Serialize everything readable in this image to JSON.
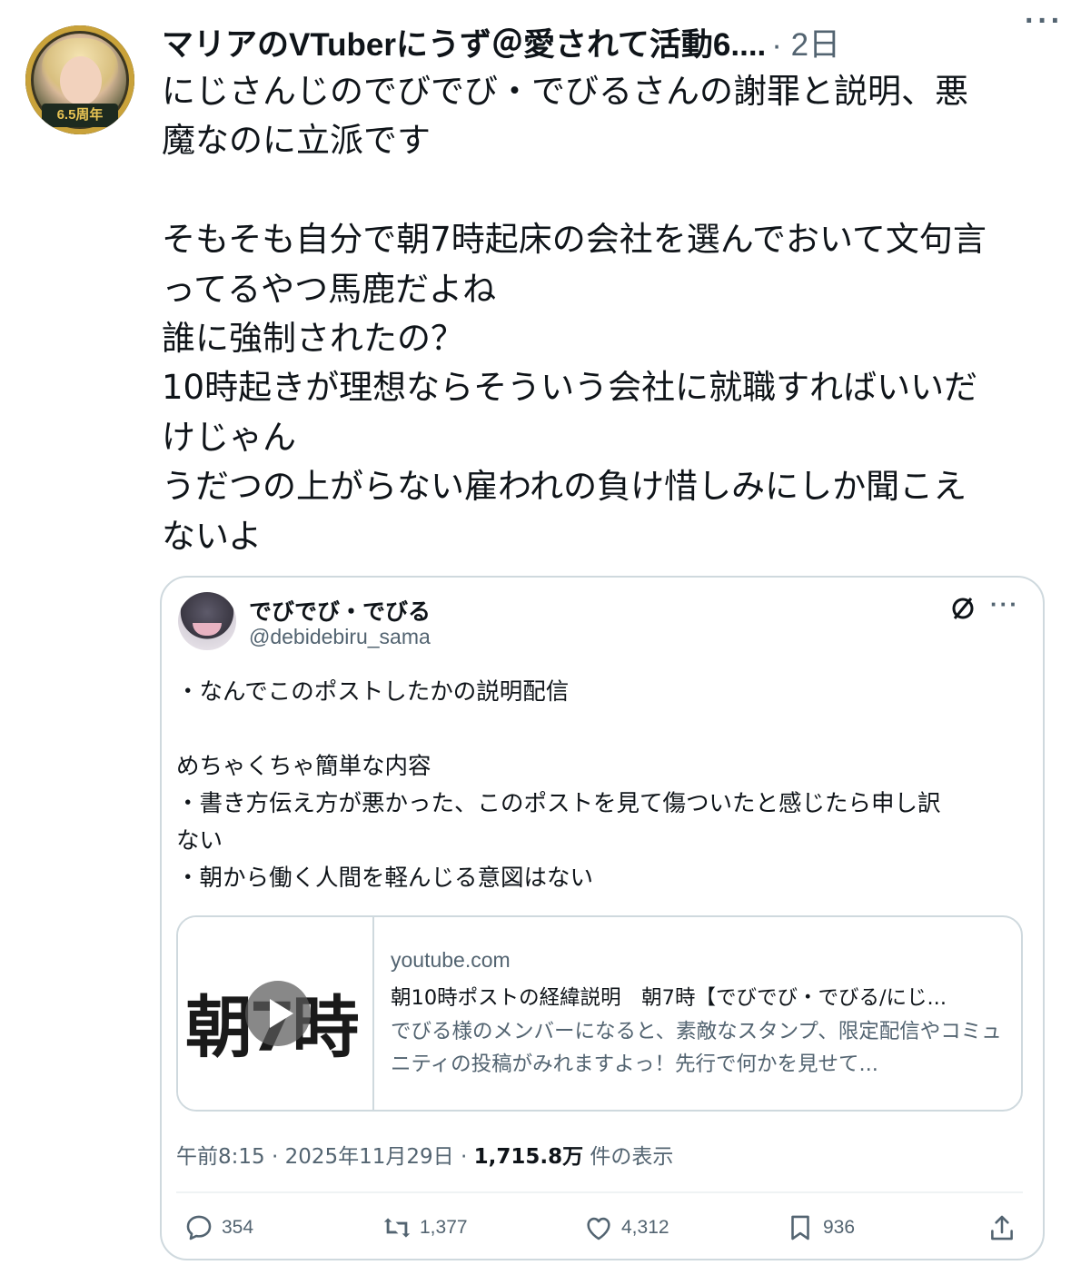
{
  "post": {
    "display_name": "マリアのVTuberにうず＠愛されて活動6....",
    "meta": "· 2日",
    "avatar_badge": "6.5周年",
    "lines": [
      "にじさんじのでびでび・でびるさんの謝罪と説明、悪",
      "魔なのに立派です",
      "",
      "そもそも自分で朝7時起床の会社を選んでおいて文句言",
      "ってるやつ馬鹿だよね",
      "誰に強制されたの？",
      "10時起きが理想ならそういう会社に就職すればいいだ",
      "けじゃん",
      "うだつの上がらない雇われの負け惜しみにしか聞こえ",
      "ないよ"
    ]
  },
  "quote": {
    "name": "でびでび・でびる",
    "handle": "@debidebiru_sama",
    "lines": [
      "・なんでこのポストしたかの説明配信",
      "",
      "めちゃくちゃ簡単な内容",
      "・書き方伝え方が悪かった、このポストを見て傷ついたと感じたら申し訳",
      "ない",
      "・朝から働く人間を軽んじる意図はない"
    ],
    "card": {
      "thumb_text": "朝7時",
      "domain": "youtube.com",
      "title": "朝10時ポストの経緯説明　朝7時【でびでび・でびる/にじ...",
      "description": "でびる様のメンバーになると、素敵なスタンプ、限定配信やコミュニティの投稿がみれますよっ！先行で何かを見せて..."
    },
    "timestamp": "午前8:15 · 2025年11月29日 · ",
    "views": "1,715.8万",
    "views_suffix": " 件の表示",
    "stats": {
      "replies": "354",
      "reposts": "1,377",
      "likes": "4,312",
      "bookmarks": "936"
    }
  },
  "colors": {
    "text": "#0f1419",
    "muted": "#536471",
    "border": "#cfd9de"
  },
  "icons": [
    "more-icon",
    "grok-icon",
    "reply-icon",
    "repost-icon",
    "like-icon",
    "bookmark-icon",
    "share-icon",
    "play-icon"
  ]
}
